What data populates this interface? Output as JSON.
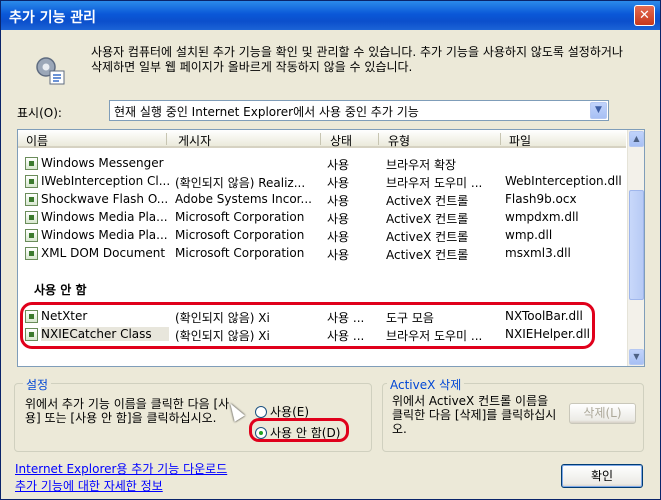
{
  "window": {
    "title": "추가 기능 관리",
    "close_glyph": "✕"
  },
  "intro": {
    "text": "사용자 컴퓨터에 설치된 추가 기능을 확인 및 관리할 수 있습니다. 추가 기능을 사용하지 않도록 설정하거나 삭제하면 일부 웹 페이지가 올바르게 작동하지 않을 수 있습니다."
  },
  "show": {
    "label": "표시(O):",
    "selected": "현재 실행 중인 Internet Explorer에서 사용 중인 추가 기능"
  },
  "list": {
    "columns": [
      "이름",
      "게시자",
      "상태",
      "유형",
      "파일"
    ],
    "enabled_rows": [
      {
        "name": "Windows Messenger",
        "publisher": "",
        "status": "사용",
        "type": "브라우저 확장",
        "file": ""
      },
      {
        "name": "IWebInterception Cl...",
        "publisher": "(확인되지 않음) Realiz...",
        "status": "사용",
        "type": "브라우저 도우미 ...",
        "file": "WebInterception.dll"
      },
      {
        "name": "Shockwave Flash O...",
        "publisher": "Adobe Systems Incor...",
        "status": "사용",
        "type": "ActiveX 컨트롤",
        "file": "Flash9b.ocx"
      },
      {
        "name": "Windows Media Pla...",
        "publisher": "Microsoft Corporation",
        "status": "사용",
        "type": "ActiveX 컨트롤",
        "file": "wmpdxm.dll"
      },
      {
        "name": "Windows Media Pla...",
        "publisher": "Microsoft Corporation",
        "status": "사용",
        "type": "ActiveX 컨트롤",
        "file": "wmp.dll"
      },
      {
        "name": "XML DOM Document",
        "publisher": "Microsoft Corporation",
        "status": "사용",
        "type": "ActiveX 컨트롤",
        "file": "msxml3.dll"
      }
    ],
    "disabled_group": "사용 안 함",
    "disabled_rows": [
      {
        "name": "NetXter",
        "publisher": "(확인되지 않음) Xi",
        "status": "사용 ...",
        "type": "도구 모음",
        "file": "NXToolBar.dll"
      },
      {
        "name": "NXIECatcher Class",
        "publisher": "(확인되지 않음) Xi",
        "status": "사용 ...",
        "type": "브라우저 도우미 ...",
        "file": "NXIEHelper.dll"
      }
    ]
  },
  "settings": {
    "legend": "설정",
    "text": "위에서 추가 기능 이름을 클릭한 다음 [사용] 또는 [사용 안 함]을 클릭하십시오.",
    "radio_enable": "사용(E)",
    "radio_disable": "사용 안 함(D)"
  },
  "activex": {
    "legend": "ActiveX 삭제",
    "text": "위에서 ActiveX 컨트롤 이름을 클릭한 다음 [삭제]를 클릭하십시오.",
    "delete_label": "삭제(L)"
  },
  "links": {
    "download": "Internet Explorer용 추가 기능 다운로드",
    "more_info": "추가 기능에 대한 자세한 정보"
  },
  "ok_label": "확인",
  "colors": {
    "highlight": "#E0001B",
    "title_bar": "#0A58D8",
    "link": "#0000FF"
  }
}
